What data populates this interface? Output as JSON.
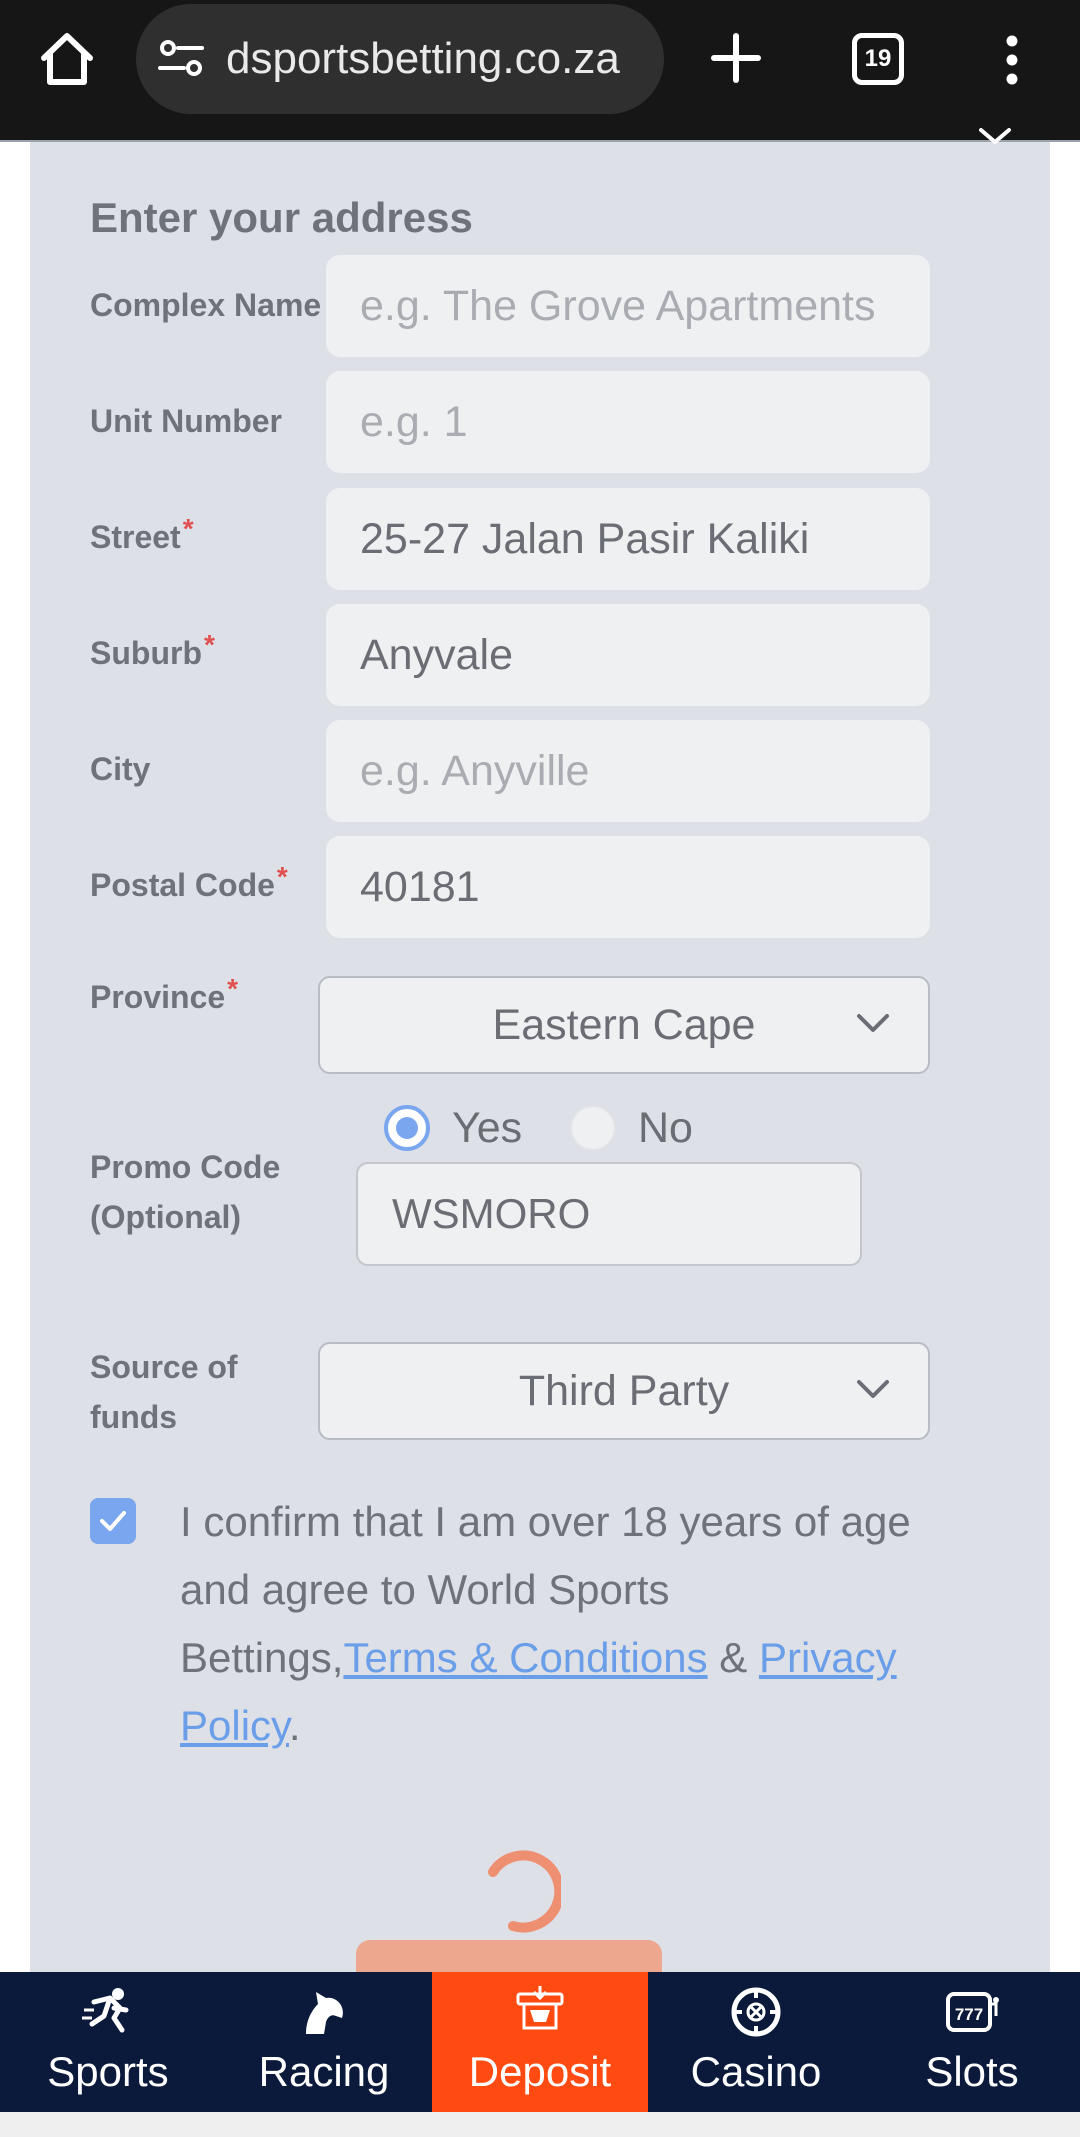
{
  "browser": {
    "url": "dsportsbetting.co.za",
    "tab_count": "19"
  },
  "form": {
    "title": "Enter your address",
    "fields": {
      "complex_name": {
        "label": "Complex Name",
        "placeholder": "e.g. The Grove Apartments"
      },
      "unit_number": {
        "label": "Unit Number",
        "placeholder": "e.g. 1"
      },
      "street": {
        "label": "Street",
        "value": "25-27 Jalan Pasir Kaliki",
        "required_mark": "*"
      },
      "suburb": {
        "label": "Suburb",
        "value": "Anyvale",
        "required_mark": "*"
      },
      "city": {
        "label": "City",
        "placeholder": "e.g. Anyville"
      },
      "postal_code": {
        "label": "Postal Code",
        "value": "40181",
        "required_mark": "*"
      },
      "province": {
        "label": "Province",
        "value": "Eastern Cape",
        "required_mark": "*"
      },
      "promo_code": {
        "label_line1": "Promo Code",
        "label_line2": "(Optional)",
        "yes_label": "Yes",
        "no_label": "No",
        "selected": "Yes",
        "value": "WSMORO"
      },
      "source_of_funds": {
        "label_line1": "Source of",
        "label_line2": "funds",
        "value": "Third Party"
      }
    },
    "confirm": {
      "text_before": "I confirm that I am over 18 years of age and agree to World Sports Bettings,",
      "terms_link": "Terms & Conditions",
      "and": " & ",
      "privacy_link": "Privacy Policy",
      "period": ".",
      "checked": true
    }
  },
  "bottom_nav": {
    "items": [
      {
        "label": "Sports",
        "icon": "runner-icon"
      },
      {
        "label": "Racing",
        "icon": "horse-icon"
      },
      {
        "label": "Deposit",
        "icon": "deposit-icon",
        "active": true
      },
      {
        "label": "Casino",
        "icon": "roulette-icon"
      },
      {
        "label": "Slots",
        "icon": "slots-777-icon"
      }
    ]
  },
  "colors": {
    "accent": "#ff4a12",
    "nav_bg": "#0b1a3b",
    "link": "#6a9ee8",
    "radio_checked": "#7aa6ef"
  }
}
